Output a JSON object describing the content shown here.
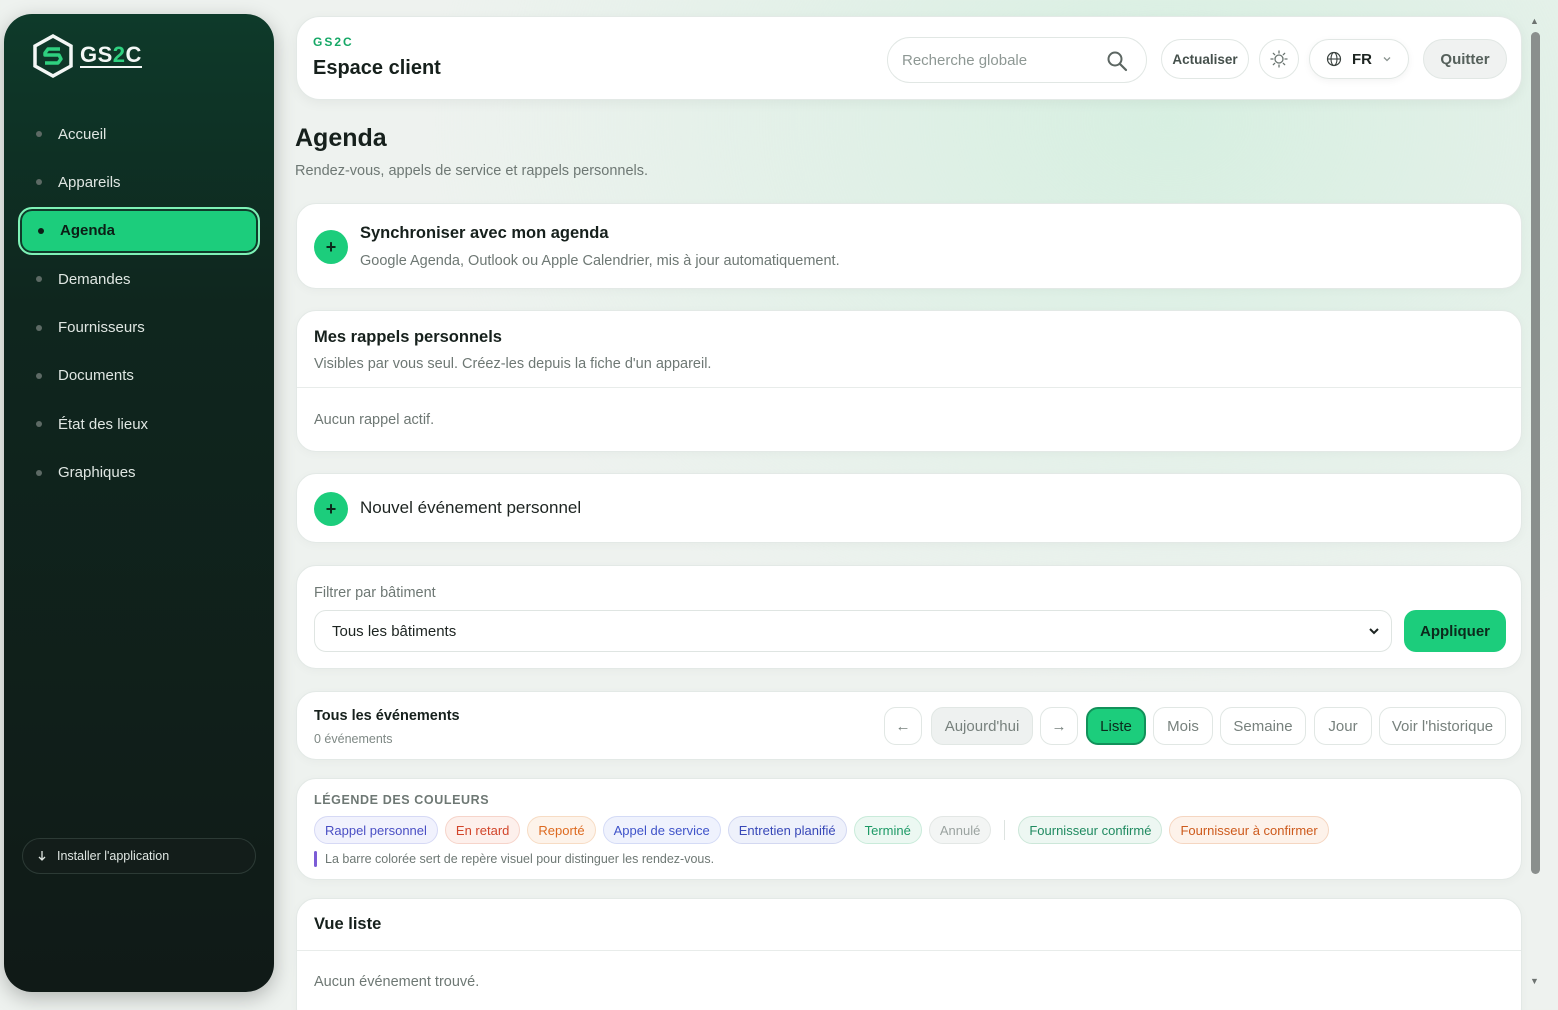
{
  "sidebar": {
    "logo_text_a": "GS",
    "logo_text_b": "2",
    "logo_text_c": "C",
    "items": [
      {
        "label": "Accueil"
      },
      {
        "label": "Appareils"
      },
      {
        "label": "Agenda"
      },
      {
        "label": "Demandes"
      },
      {
        "label": "Fournisseurs"
      },
      {
        "label": "Documents"
      },
      {
        "label": "État des lieux"
      },
      {
        "label": "Graphiques"
      }
    ],
    "active_index": 2,
    "install_label": "Installer l'application"
  },
  "header": {
    "brand": "GS2C",
    "title": "Espace client",
    "search_placeholder": "Recherche globale",
    "refresh_label": "Actualiser",
    "lang_label": "FR",
    "quit_label": "Quitter"
  },
  "page": {
    "title": "Agenda",
    "subtitle": "Rendez-vous, appels de service et rappels personnels."
  },
  "sync": {
    "plus": "+",
    "title": "Synchroniser avec mon agenda",
    "text": "Google Agenda, Outlook ou Apple Calendrier, mis à jour automatiquement."
  },
  "reminders": {
    "title": "Mes rappels personnels",
    "text": "Visibles par vous seul. Créez-les depuis la fiche d'un appareil.",
    "empty": "Aucun rappel actif."
  },
  "new_event": {
    "plus": "+",
    "label": "Nouvel événement personnel"
  },
  "filter": {
    "label": "Filtrer par bâtiment",
    "selected": "Tous les bâtiments",
    "apply_label": "Appliquer"
  },
  "events": {
    "title": "Tous les événements",
    "count": "0 événements",
    "prev": "←",
    "today": "Aujourd'hui",
    "next": "→",
    "views": {
      "list": "Liste",
      "month": "Mois",
      "week": "Semaine",
      "day": "Jour",
      "history": "Voir l'historique"
    }
  },
  "legend": {
    "title": "LÉGENDE DES COULEURS",
    "chips": [
      {
        "label": "Rappel personnel",
        "color": "#4a4fc4",
        "bg": "#f1f2fd",
        "border": "#d6d9f5"
      },
      {
        "label": "En retard",
        "color": "#d2452a",
        "bg": "#fdf0ec",
        "border": "#f6d4ca"
      },
      {
        "label": "Reporté",
        "color": "#dd6a20",
        "bg": "#fdf3ea",
        "border": "#f7dcc4"
      },
      {
        "label": "Appel de service",
        "color": "#3f53c9",
        "bg": "#eff2fd",
        "border": "#d4dbf6"
      },
      {
        "label": "Entretien planifié",
        "color": "#3848b8",
        "bg": "#eef1fb",
        "border": "#d3d8f1"
      },
      {
        "label": "Terminé",
        "color": "#1d9a66",
        "bg": "#ecf8f2",
        "border": "#c9ebda"
      },
      {
        "label": "Annulé",
        "color": "#9ba3a0",
        "bg": "#f3f5f4",
        "border": "#e3e7e5"
      },
      {
        "label": "Fournisseur confirmé",
        "color": "#1f8a60",
        "bg": "#edf7f2",
        "border": "#cce7d9"
      },
      {
        "label": "Fournisseur à confirmer",
        "color": "#cd5a1c",
        "bg": "#fdf2ea",
        "border": "#f5d6c1"
      }
    ],
    "note": "La barre colorée sert de repère visuel pour distinguer les rendez-vous."
  },
  "list_view": {
    "title": "Vue liste",
    "empty": "Aucun événement trouvé."
  },
  "colors": {
    "accent": "#1ccd7c",
    "sidebar_bg": "#0f261e"
  }
}
